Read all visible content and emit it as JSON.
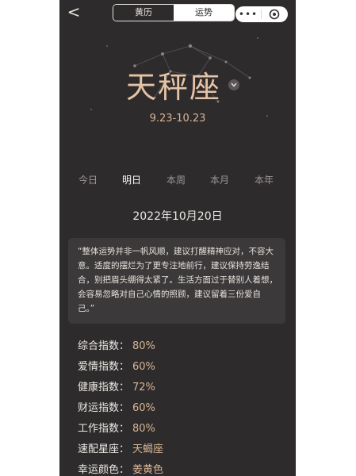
{
  "header": {
    "back_label": "<",
    "tabs": [
      {
        "label": "黄历",
        "active": false
      },
      {
        "label": "运势",
        "active": true
      }
    ],
    "more_label": "•••",
    "icons": [
      "chevron-left-icon",
      "more-icon",
      "close-icon"
    ]
  },
  "hero": {
    "sign": "天秤座",
    "dates": "9.23-10.23"
  },
  "period_tabs": [
    {
      "label": "今日",
      "active": false
    },
    {
      "label": "明日",
      "active": true
    },
    {
      "label": "本周",
      "active": false
    },
    {
      "label": "本月",
      "active": false
    },
    {
      "label": "本年",
      "active": false
    }
  ],
  "date": "2022年10月20日",
  "quote": "“整体运势并非一帆风顺，建议打醒精神应对，不容大意。适度的摆烂为了更专注地前行，建议保持劳逸结合，别把眉头绷得太紧了。生活方面过于替别人着想，会容易忽略对自己心情的照顾，建议留着三份爱自己。”",
  "stats": [
    {
      "key": "综合指数：",
      "value": "80%"
    },
    {
      "key": "爱情指数：",
      "value": "60%"
    },
    {
      "key": "健康指数：",
      "value": "72%"
    },
    {
      "key": "财运指数：",
      "value": "60%"
    },
    {
      "key": "工作指数：",
      "value": "80%"
    },
    {
      "key": "速配星座：",
      "value": "天蝎座"
    },
    {
      "key": "幸运颜色：",
      "value": "姜黄色"
    }
  ],
  "colors": {
    "background": "#2e2b2c",
    "accent": "#d8b596",
    "sign": "#e5c3a4",
    "quote_bg": "#3c393a"
  }
}
